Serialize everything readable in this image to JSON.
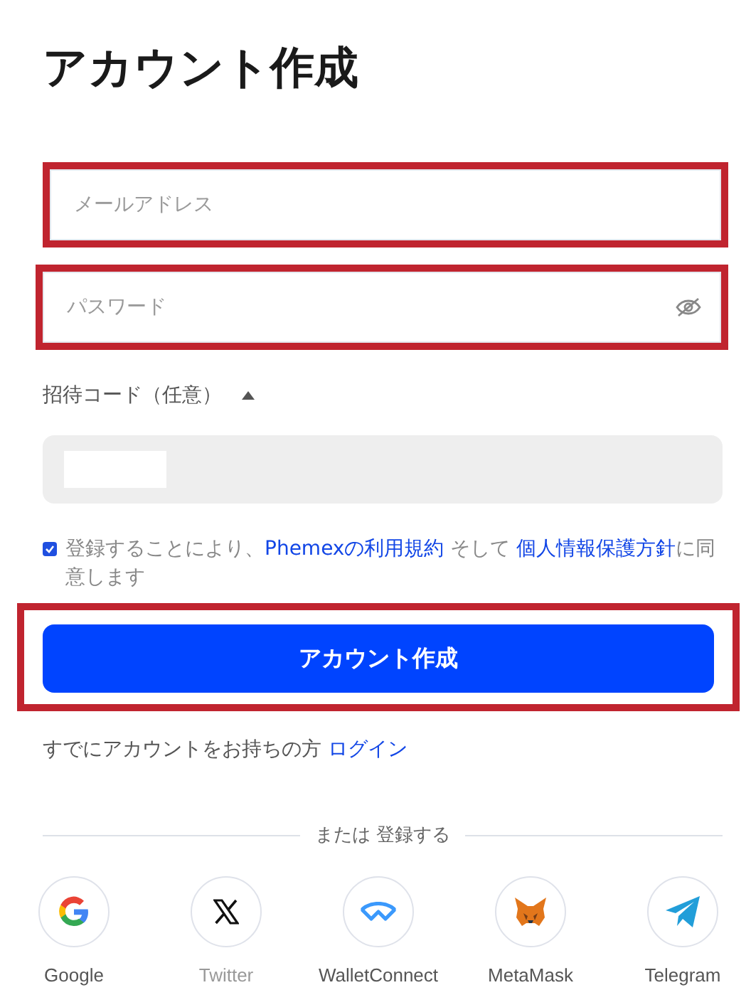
{
  "title": "アカウント作成",
  "email_field": {
    "placeholder": "メールアドレス",
    "highlighted": true
  },
  "password_field": {
    "placeholder": "パスワード",
    "highlighted": true
  },
  "invite_code": {
    "label": "招待コード（任意）",
    "expanded": true,
    "value_redacted": true
  },
  "agreement": {
    "checked": true,
    "text_before": "登録することにより、",
    "terms_link": "Phemexの利用規約",
    "text_middle": " そして ",
    "privacy_link": "個人情報保護方針",
    "text_after": "に同意します"
  },
  "submit_button": {
    "label": "アカウント作成",
    "highlighted": true
  },
  "login_prompt": {
    "text": "すでにアカウントをお持ちの方",
    "link": "ログイン"
  },
  "divider_text": "または 登録する",
  "social_logins": [
    {
      "kind": "google",
      "label": "Google",
      "disabled": false
    },
    {
      "kind": "x",
      "label": "Twitter",
      "disabled": true
    },
    {
      "kind": "walletconnect",
      "label": "WalletConnect",
      "disabled": false
    },
    {
      "kind": "metamask",
      "label": "MetaMask",
      "disabled": false
    },
    {
      "kind": "telegram",
      "label": "Telegram",
      "disabled": false
    }
  ]
}
